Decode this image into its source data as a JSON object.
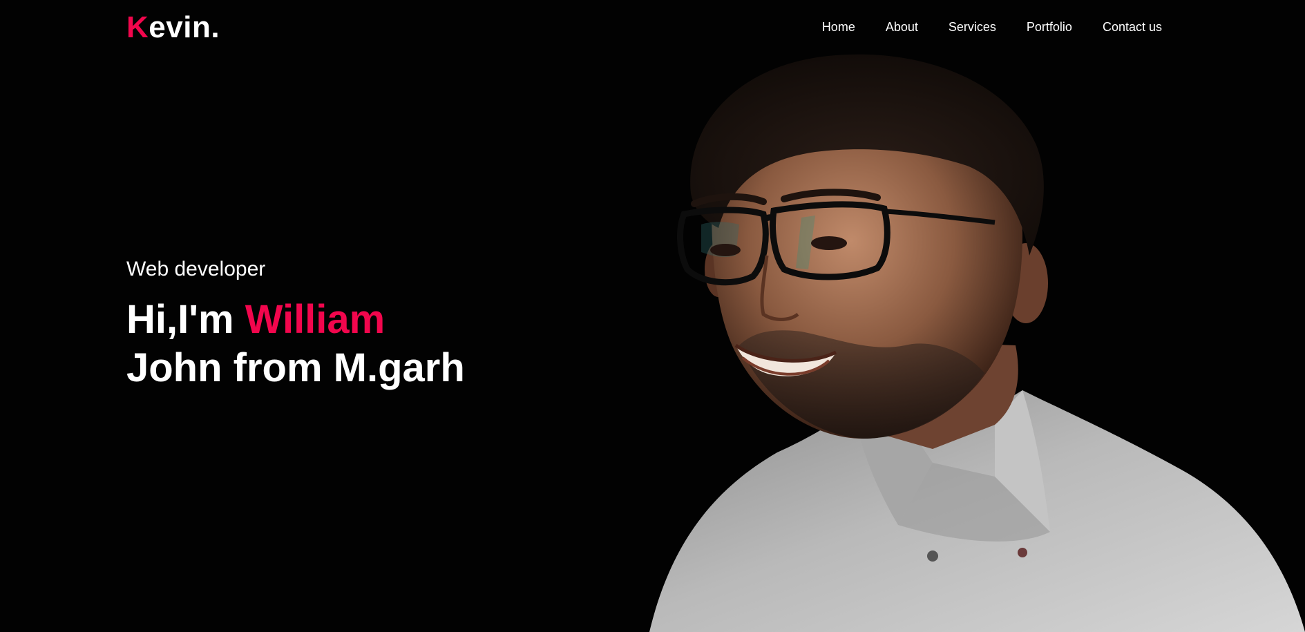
{
  "brand": {
    "logo_first_letter": "K",
    "logo_rest": "evin.",
    "accent_color": "#f2064d"
  },
  "nav": {
    "items": [
      "Home",
      "About",
      "Services",
      "Portfolio",
      "Contact us"
    ]
  },
  "hero": {
    "subtitle": "Web developer",
    "greeting": "Hi,I'm ",
    "first_name": "William",
    "line2": "John from M.garh",
    "image": "portrait-photo"
  },
  "colors": {
    "background": "#020202",
    "text": "#ffffff",
    "accent": "#f2064d"
  }
}
